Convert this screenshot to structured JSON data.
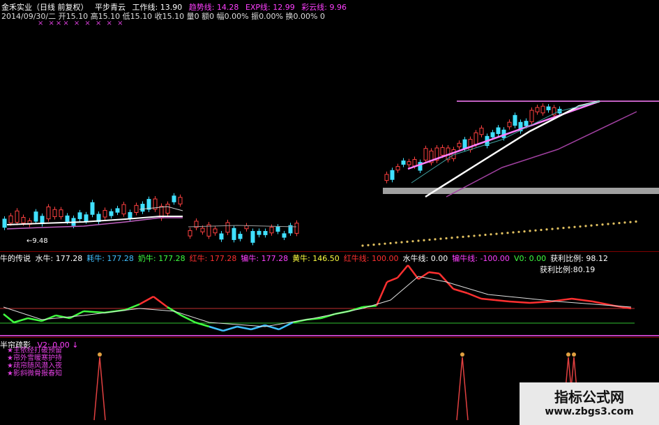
{
  "header": {
    "title": "金禾实业（日线 前复权）",
    "formula": "平步青云",
    "work_label": "工作线:",
    "work_value": "13.90",
    "trend_label": "趋势线:",
    "trend_value": "14.28",
    "exp_label": "EXP线:",
    "exp_value": "12.99",
    "cloud_label": "彩云线:",
    "cloud_value": "9.96"
  },
  "ohlc": {
    "date": "2014/09/30/二",
    "open_label": "开",
    "open": "15.10",
    "high_label": "高",
    "high": "15.10",
    "low_label": "低",
    "low": "15.10",
    "close_label": "收",
    "close": "15.10",
    "vol_label": "量",
    "vol": "0",
    "amount_label": "额",
    "amount": "0",
    "amp_label": "幅",
    "amp": "0.00%",
    "change_label": "振",
    "change": "0.00%",
    "turnover_label": "换",
    "turnover": "0.00%",
    "extra": "0"
  },
  "markers": "× ×××  ×   ×  ×   ×  ×",
  "price_label": "9.48",
  "indicator": {
    "name": "牛的传说",
    "items": [
      {
        "label": "水牛:",
        "value": "177.28",
        "color": "#ffffff"
      },
      {
        "label": "耗牛:",
        "value": "177.28",
        "color": "#40c0ff"
      },
      {
        "label": "奶牛:",
        "value": "177.28",
        "color": "#40ff40"
      },
      {
        "label": "红牛:",
        "value": "177.28",
        "color": "#ff3030"
      },
      {
        "label": "犏牛:",
        "value": "177.28",
        "color": "#ff40ff"
      },
      {
        "label": "黄牛:",
        "value": "146.50",
        "color": "#ffff40"
      },
      {
        "label": "红牛线:",
        "value": "100.00",
        "color": "#ff3030"
      },
      {
        "label": "水牛线:",
        "value": "0.00",
        "color": "#ffffff"
      },
      {
        "label": "犏牛线:",
        "value": "-100.00",
        "color": "#ff40ff"
      },
      {
        "label": "V0:",
        "value": "0.00",
        "color": "#40ff40"
      },
      {
        "label": "获利比例:",
        "value": "98.12",
        "color": "#ffffff"
      }
    ],
    "ratio_label": "获利比例:",
    "ratio_value": "80.19"
  },
  "panel3": {
    "name": "半帘疏影",
    "v2_label": "V2:",
    "v2_value": "0.00",
    "notes": [
      "★主依经打破预留",
      "★帘外雪暖寒护持",
      "★疏帘随风潜入夜",
      "★影斜微骨报春知"
    ]
  },
  "watermark": {
    "title": "指标公式网",
    "url": "www.zbgs3.com"
  },
  "colors": {
    "background": "#000000",
    "up": "#ff4040",
    "down": "#40e0ff",
    "divider": "#800000",
    "magenta": "#ff40ff"
  }
}
